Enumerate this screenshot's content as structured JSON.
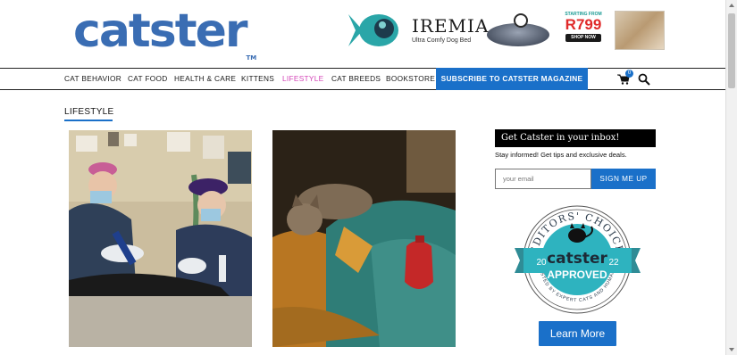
{
  "header": {
    "logo_text": "catster",
    "logo_tm": "TM",
    "logo_color": "#3a6db3"
  },
  "ad": {
    "brand": "IREMIA",
    "tagline": "Ultra Comfy Dog Bed",
    "starting_from": "STARTING FROM",
    "price": "R799",
    "shop_now": "SHOP NOW",
    "accent_color": "#1a9b94"
  },
  "nav": {
    "items": [
      "CAT BEHAVIOR",
      "CAT FOOD",
      "HEALTH & CARE",
      "KITTENS",
      "LIFESTYLE",
      "CAT BREEDS",
      "BOOKSTORE"
    ],
    "active": "LIFESTYLE",
    "active_color": "#d444b8",
    "subscribe_label": "SUBSCRIBE TO CATSTER MAGAZINE",
    "cart_count": "0",
    "cart_icon": "shopping-cart-icon",
    "search_icon": "search-icon"
  },
  "main": {
    "section_title": "LIFESTYLE"
  },
  "sidebar": {
    "newsletter_title": "Get Catster in your inbox!",
    "newsletter_desc": "Stay informed! Get tips and exclusive deals.",
    "email_placeholder": "your email",
    "sign_up_label": "SIGN ME UP",
    "award": {
      "top_text": "EDITORS' CHOICE",
      "brand": "catster",
      "approved": "APPROVED",
      "year_left": "20",
      "year_right": "22",
      "bottom_text": "TESTED BY EXPERT CATS AND HUMANS"
    },
    "learn_more_label": "Learn More"
  },
  "colors": {
    "primary": "#1a70c9",
    "badge_teal": "#2eb3bf"
  }
}
